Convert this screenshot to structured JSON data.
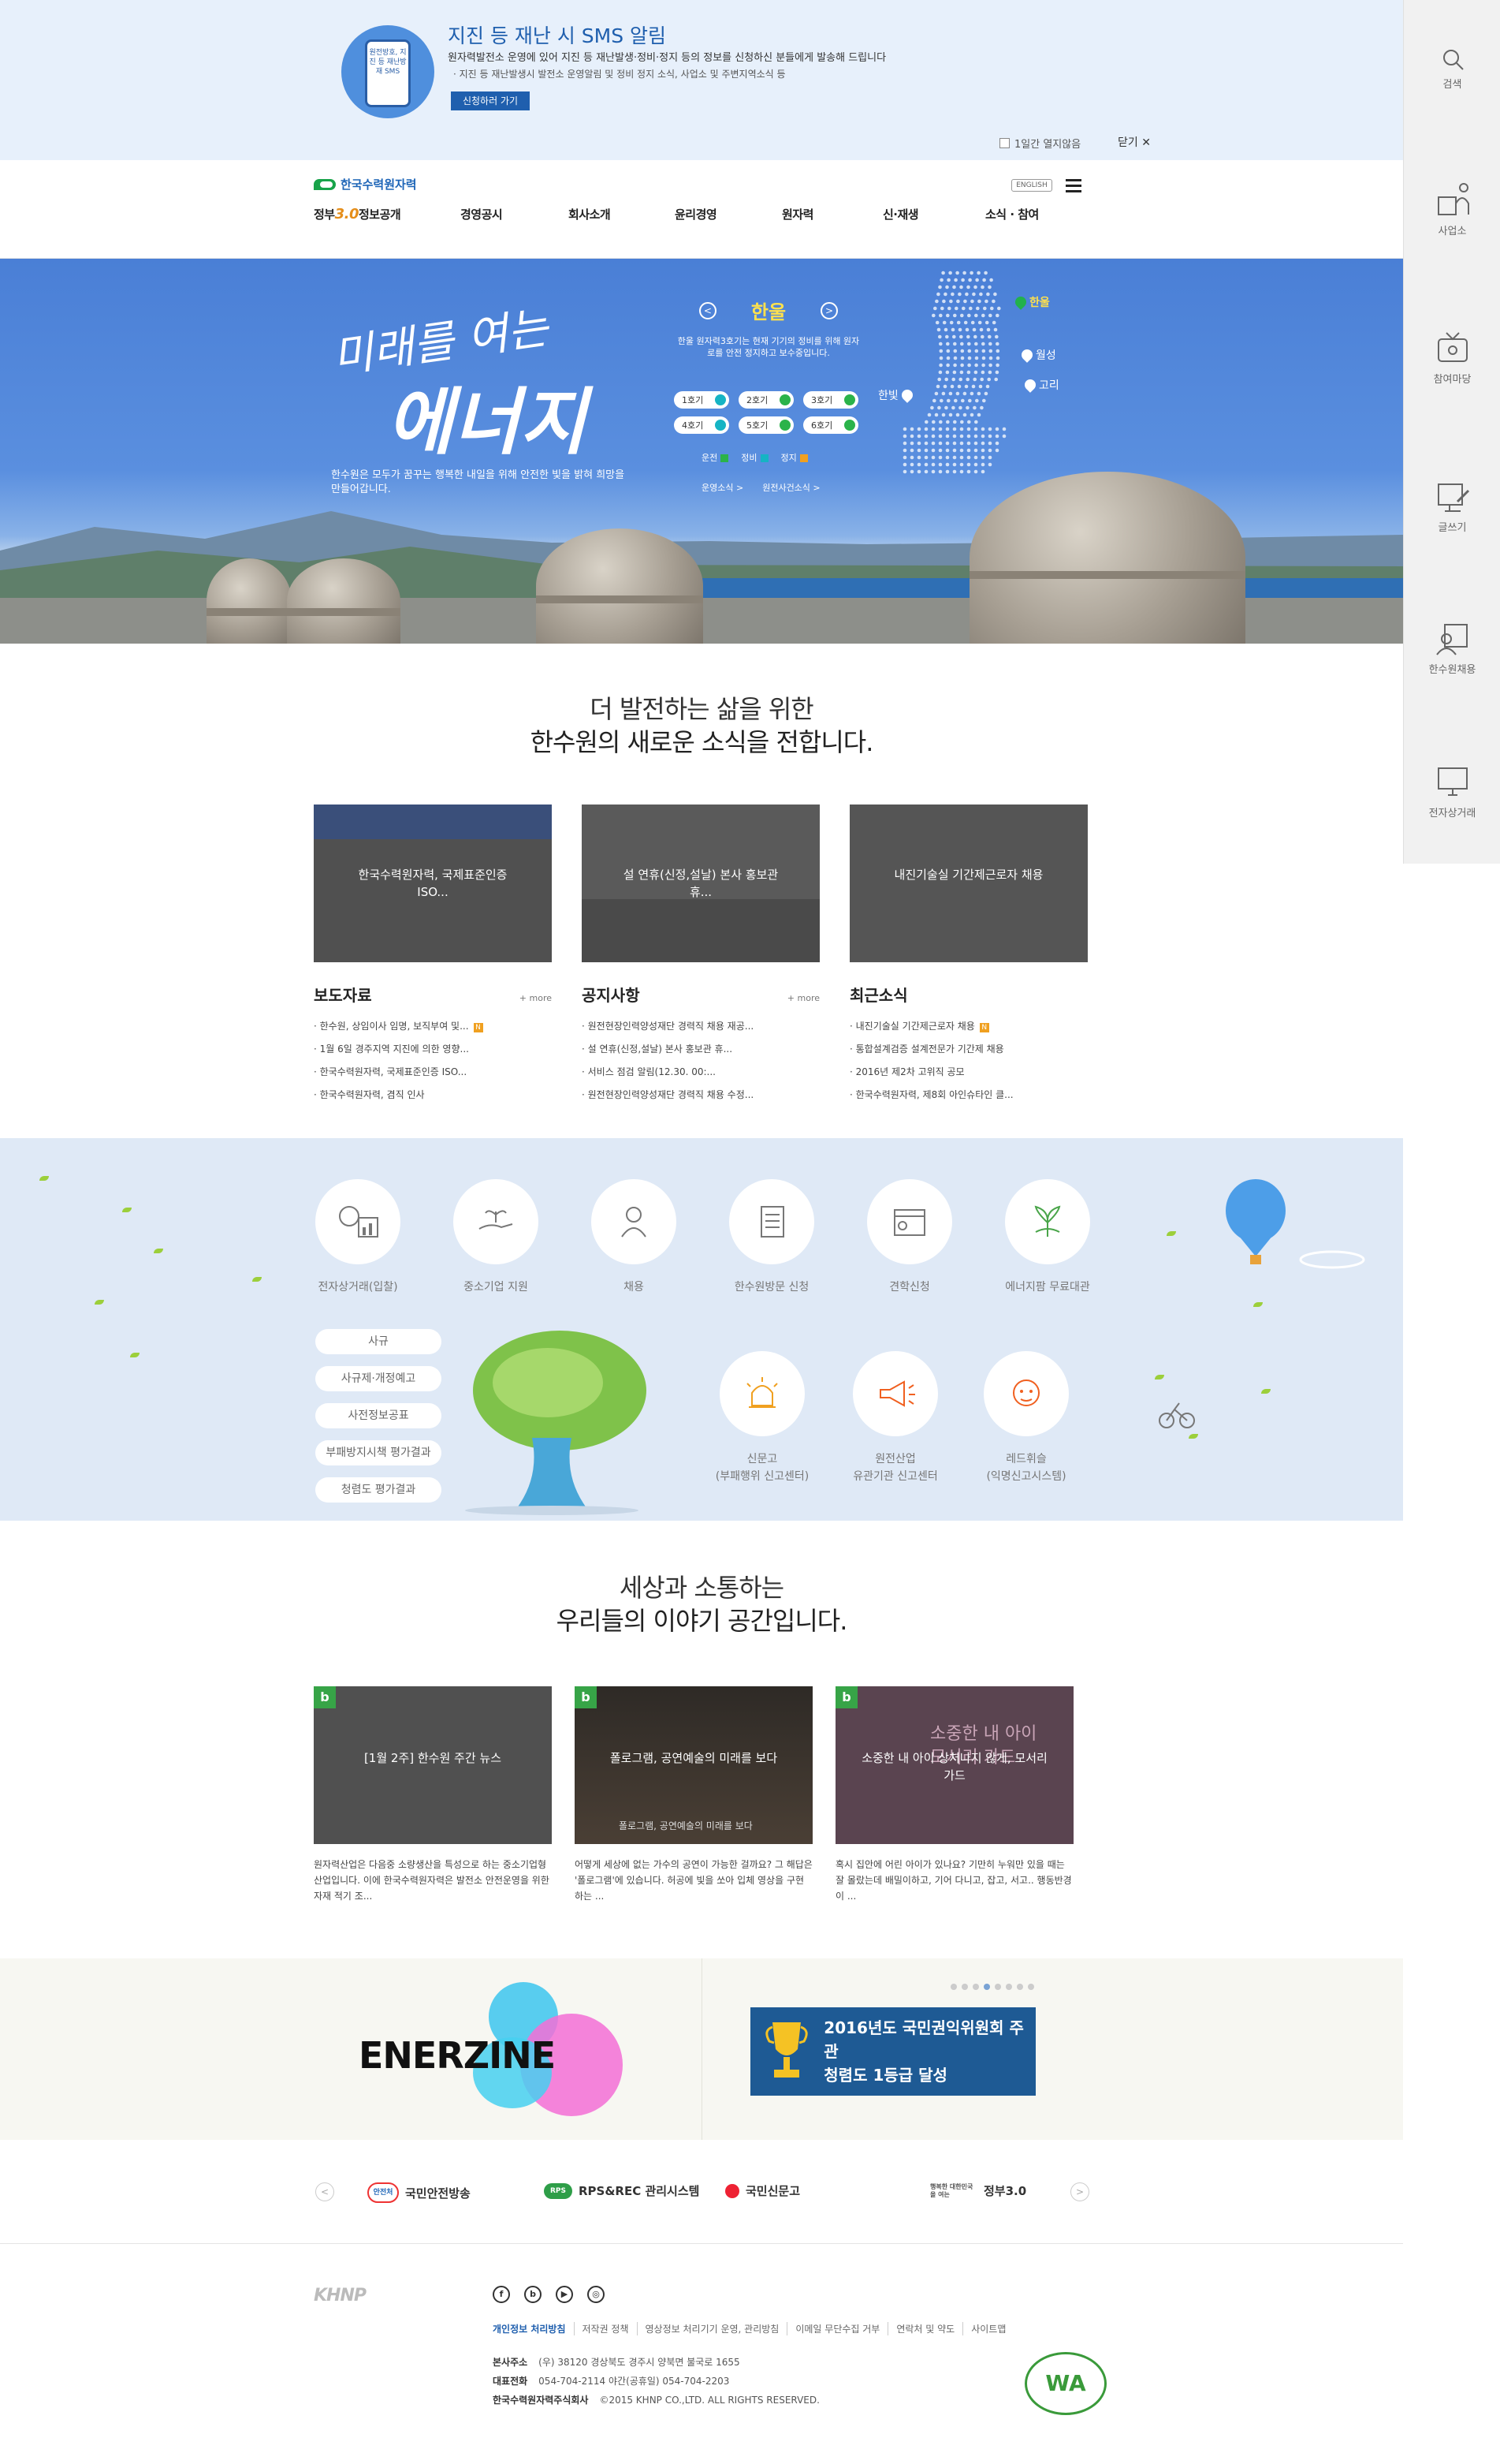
{
  "sms_banner": {
    "phone_text": "원전방호, 지진 등 재난방재 SMS",
    "title": "지진 등 재난 시 SMS 알림",
    "desc1": "원자력발전소 운영에 있어 지진 등 재난발생·정비·정지 등의 정보를 신청하신 분들에게 발송해 드립니다",
    "desc2": "· 지진 등 재난발생시 발전소 운영알림 및 정비 정지 소식, 사업소 및 주변지역소식 등",
    "apply_label": "신청하러 가기",
    "noshow_label": "1일간 열지않음",
    "close_label": "닫기 ✕"
  },
  "header": {
    "logo_text": "한국수력원자력",
    "english_label": "ENGLISH",
    "nav": [
      {
        "label": "정보공개",
        "prefix": "정부",
        "three": "3.0"
      },
      {
        "label": "경영공시"
      },
      {
        "label": "회사소개"
      },
      {
        "label": "윤리경영"
      },
      {
        "label": "원자력"
      },
      {
        "label": "신·재생"
      },
      {
        "label": "소식 · 참여"
      }
    ]
  },
  "quickbar": {
    "items": [
      {
        "label": "검색",
        "icon": "search-icon"
      },
      {
        "label": "사업소",
        "icon": "plant-icon"
      },
      {
        "label": "참여마당",
        "icon": "tv-icon"
      },
      {
        "label": "글쓰기",
        "icon": "write-icon"
      },
      {
        "label": "한수원채용",
        "icon": "recruit-icon"
      },
      {
        "label": "전자상거래",
        "icon": "monitor-icon"
      }
    ]
  },
  "hero": {
    "slogan_line1": "미래를 여는",
    "slogan_line2": "에너지",
    "tagline": "한수원은 모두가 꿈꾸는 행복한 내일을 위해 안전한 빛을 밝혀 희망을 만들어갑니다.",
    "plant_name": "한울",
    "plant_desc": "한울 원자력3호기는 현재 기기의 정비를 위해 원자로를 안전 정지하고 보수중입니다.",
    "units": [
      {
        "label": "1호기",
        "status": "blue"
      },
      {
        "label": "2호기",
        "status": "green"
      },
      {
        "label": "3호기",
        "status": "green"
      },
      {
        "label": "4호기",
        "status": "blue"
      },
      {
        "label": "5호기",
        "status": "green"
      },
      {
        "label": "6호기",
        "status": "green"
      }
    ],
    "legend": [
      {
        "label": "운전",
        "color": "#2bb34a"
      },
      {
        "label": "정비",
        "color": "#16b4c4"
      },
      {
        "label": "정지",
        "color": "#f0a020"
      }
    ],
    "links": [
      "운영소식 >",
      "원전사건소식 >"
    ],
    "sites": [
      "한울",
      "월성",
      "고리",
      "한빛"
    ]
  },
  "news_section": {
    "title_line1": "더 발전하는 삶을 위한",
    "title_line2": "한수원의 새로운 소식을 전합니다.",
    "columns": [
      {
        "thumb_caption": "한국수력원자력, 국제표준인증 ISO...",
        "heading": "보도자료",
        "more": "+ more",
        "items": [
          {
            "text": "한수원, 상임이사 임명, 보직부여 및...",
            "new": true
          },
          {
            "text": "1월 6일 경주지역 지진에 의한 영향...",
            "new": false
          },
          {
            "text": "한국수력원자력, 국제표준인증 ISO...",
            "new": false
          },
          {
            "text": "한국수력원자력, 겸직 인사",
            "new": false
          }
        ]
      },
      {
        "thumb_caption": "설 연휴(신정,설날) 본사 홍보관 휴...",
        "heading": "공지사항",
        "more": "+ more",
        "items": [
          {
            "text": "원전현장인력양성재단 경력직 채용 재공...",
            "new": false
          },
          {
            "text": "설 연휴(신정,설날) 본사 홍보관 휴...",
            "new": false
          },
          {
            "text": "서비스 점검 알림(12.30. 00:...",
            "new": false
          },
          {
            "text": "원전현장인력양성재단 경력직 채용 수정...",
            "new": false
          }
        ]
      },
      {
        "thumb_caption": "내진기술실 기간제근로자 채용",
        "heading": "최근소식",
        "more": "",
        "items": [
          {
            "text": "내진기술실 기간제근로자 채용",
            "new": true
          },
          {
            "text": "통합설계검증 설계전문가 기간제 채용",
            "new": false
          },
          {
            "text": "2016년 제2차 고위직 공모",
            "new": false
          },
          {
            "text": "한국수력원자력, 제8회 아인슈타인 클...",
            "new": false
          }
        ]
      }
    ]
  },
  "services": {
    "top_row": [
      {
        "label": "전자상거래(입찰)",
        "icon": "ecommerce-icon"
      },
      {
        "label": "중소기업 지원",
        "icon": "sme-support-icon"
      },
      {
        "label": "채용",
        "icon": "recruit-person-icon"
      },
      {
        "label": "한수원방문 신청",
        "icon": "visit-checklist-icon"
      },
      {
        "label": "견학신청",
        "icon": "tour-calendar-icon"
      },
      {
        "label": "에너지팜 무료대관",
        "icon": "energy-farm-icon"
      }
    ],
    "pills": [
      "사규",
      "사규제·개정예고",
      "사전정보공표",
      "부패방지시책 평가결과",
      "청렴도 평가결과"
    ],
    "bottom_row": [
      {
        "label1": "신문고",
        "label2": "(부패행위 신고센터)",
        "icon": "siren-icon"
      },
      {
        "label1": "원전산업",
        "label2": "유관기관 신고센터",
        "icon": "megaphone-icon"
      },
      {
        "label1": "레드휘슬",
        "label2": "(익명신고시스템)",
        "icon": "whistle-person-icon"
      }
    ]
  },
  "blog_section": {
    "title_line1": "세상과 소통하는",
    "title_line2": "우리들의 이야기 공간입니다.",
    "badge": "b",
    "posts": [
      {
        "caption": "[1월 2주] 한수원 주간 뉴스",
        "overlay": "",
        "text": "원자력산업은 다음중 소량생산을 특성으로 하는 중소기업형 산업입니다. 이에 한국수력원자력은 발전소 안전운영을 위한 자재 적기 조..."
      },
      {
        "caption": "폴로그램, 공연예술의 미래를 보다",
        "overlay": "폴로그램, 공연예술의 미래를 보다",
        "text": "어떻게 세상에 없는 가수의 공연이 가능한 걸까요? 그 해답은 '폴로그램'에 있습니다. 허공에 빛을 쏘아 입체 영상을 구현하는 ..."
      },
      {
        "caption": "소중한 내 아이 상처나지 않게, 모서리가드",
        "overlay": "소중한 내 아이 모서리 가드",
        "text": "혹시 집안에 어린 아이가 있나요? 기만히 누워만 있을 때는 잘 몰랐는데 배밀이하고, 기어 다니고, 잡고, 서고.. 행동반경이 ..."
      }
    ]
  },
  "promo": {
    "enerzine": "ENERZINE",
    "award_line1": "2016년도 국민권익위원회 주관",
    "award_line2": "청렴도 1등급 달성",
    "dot_count": 8,
    "active_dot": 4
  },
  "partners": {
    "items": [
      {
        "label": "국민안전방송",
        "badge": "안전처"
      },
      {
        "label": "RPS&REC 관리시스템",
        "badge": "RPS"
      },
      {
        "label": "국민신문고",
        "badge": "신문고"
      },
      {
        "label": "정부3.0",
        "badge": "행복한 대한민국을 여는"
      }
    ]
  },
  "footer": {
    "logo": "KHNP",
    "sns": [
      "f",
      "b",
      "▶",
      "◎"
    ],
    "links": [
      "개인정보 처리방침",
      "저작권 정책",
      "영상정보 처리기기 운영, 관리방침",
      "이메일 무단수집 거부",
      "연락처 및 약도",
      "사이트맵"
    ],
    "address_label": "본사주소",
    "address": "(우) 38120 경상북도 경주시 양북면 불국로 1655",
    "phone_label": "대표전화",
    "phone": "054-704-2114 야간(공휴일) 054-704-2203",
    "copyright_label": "한국수력원자력주식회사",
    "copyright": "©2015 KHNP CO.,LTD. ALL RIGHTS RESERVED.",
    "wa_badge": "WA"
  }
}
